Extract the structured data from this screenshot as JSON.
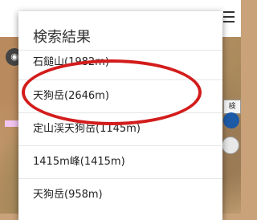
{
  "dialog": {
    "title": "検索結果"
  },
  "results": [
    {
      "label": "石鎚山(1982m)"
    },
    {
      "label": "天狗岳(2646m)"
    },
    {
      "label": "定山渓天狗岳(1145m)"
    },
    {
      "label": "1415m峰(1415m)"
    },
    {
      "label": "天狗岳(958m)"
    }
  ],
  "map": {
    "badge_text": "検",
    "highlight_color": "#d31c1c"
  }
}
